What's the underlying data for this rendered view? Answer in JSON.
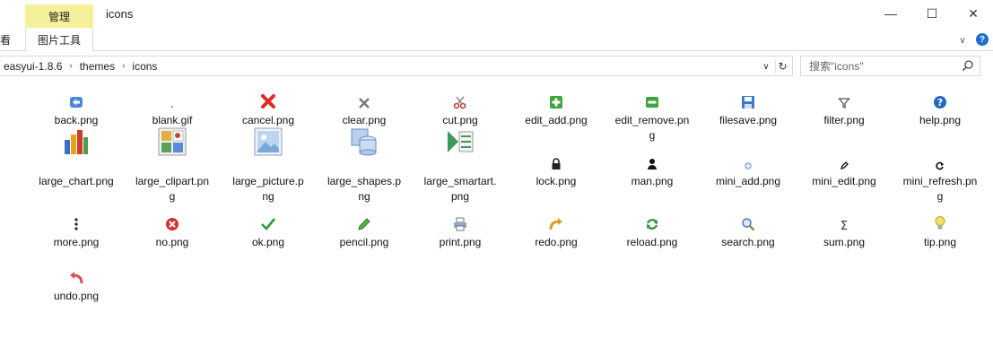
{
  "window": {
    "context_tab": "管理",
    "title": "icons",
    "min_glyph": "—",
    "max_glyph": "☐",
    "close_glyph": "✕"
  },
  "ribbon": {
    "view_tab": "看",
    "picture_tools_tab": "图片工具",
    "chevron_glyph": "∨",
    "help_glyph": "?"
  },
  "address": {
    "crumbs": [
      "easyui-1.8.6",
      "themes",
      "icons"
    ],
    "separator": "›",
    "dropdown_glyph": "∨",
    "refresh_glyph": "↻"
  },
  "search": {
    "placeholder": "搜索\"icons\""
  },
  "files": [
    {
      "name": "back.png",
      "icon": "back-icon"
    },
    {
      "name": "blank.gif",
      "icon": "blank-icon"
    },
    {
      "name": "cancel.png",
      "icon": "cancel-icon"
    },
    {
      "name": "clear.png",
      "icon": "clear-icon"
    },
    {
      "name": "cut.png",
      "icon": "cut-icon"
    },
    {
      "name": "edit_add.png",
      "icon": "edit-add-icon"
    },
    {
      "name": "edit_remove.png",
      "icon": "edit-remove-icon"
    },
    {
      "name": "filesave.png",
      "icon": "filesave-icon"
    },
    {
      "name": "filter.png",
      "icon": "filter-icon"
    },
    {
      "name": "help.png",
      "icon": "help-icon"
    },
    {
      "name": "large_chart.png",
      "icon": "large-chart-icon"
    },
    {
      "name": "large_clipart.png",
      "icon": "large-clipart-icon"
    },
    {
      "name": "large_picture.png",
      "icon": "large-picture-icon"
    },
    {
      "name": "large_shapes.png",
      "icon": "large-shapes-icon"
    },
    {
      "name": "large_smartart.png",
      "icon": "large-smartart-icon"
    },
    {
      "name": "lock.png",
      "icon": "lock-icon"
    },
    {
      "name": "man.png",
      "icon": "man-icon"
    },
    {
      "name": "mini_add.png",
      "icon": "mini-add-icon"
    },
    {
      "name": "mini_edit.png",
      "icon": "mini-edit-icon"
    },
    {
      "name": "mini_refresh.png",
      "icon": "mini-refresh-icon"
    },
    {
      "name": "more.png",
      "icon": "more-icon"
    },
    {
      "name": "no.png",
      "icon": "no-icon"
    },
    {
      "name": "ok.png",
      "icon": "ok-icon"
    },
    {
      "name": "pencil.png",
      "icon": "pencil-icon"
    },
    {
      "name": "print.png",
      "icon": "print-icon"
    },
    {
      "name": "redo.png",
      "icon": "redo-icon"
    },
    {
      "name": "reload.png",
      "icon": "reload-icon"
    },
    {
      "name": "search.png",
      "icon": "search-file-icon"
    },
    {
      "name": "sum.png",
      "icon": "sum-icon"
    },
    {
      "name": "tip.png",
      "icon": "tip-icon"
    },
    {
      "name": "undo.png",
      "icon": "undo-icon"
    }
  ],
  "lines": {
    "edit_remove.png": [
      "edit_remove.pn",
      "g"
    ],
    "large_clipart.png": [
      "large_clipart.pn",
      "g"
    ],
    "large_picture.png": [
      "large_picture.p",
      "ng"
    ],
    "large_shapes.png": [
      "large_shapes.p",
      "ng"
    ],
    "large_smartart.png": [
      "large_smartart.",
      "png"
    ],
    "mini_refresh.png": [
      "mini_refresh.pn",
      "g"
    ]
  }
}
